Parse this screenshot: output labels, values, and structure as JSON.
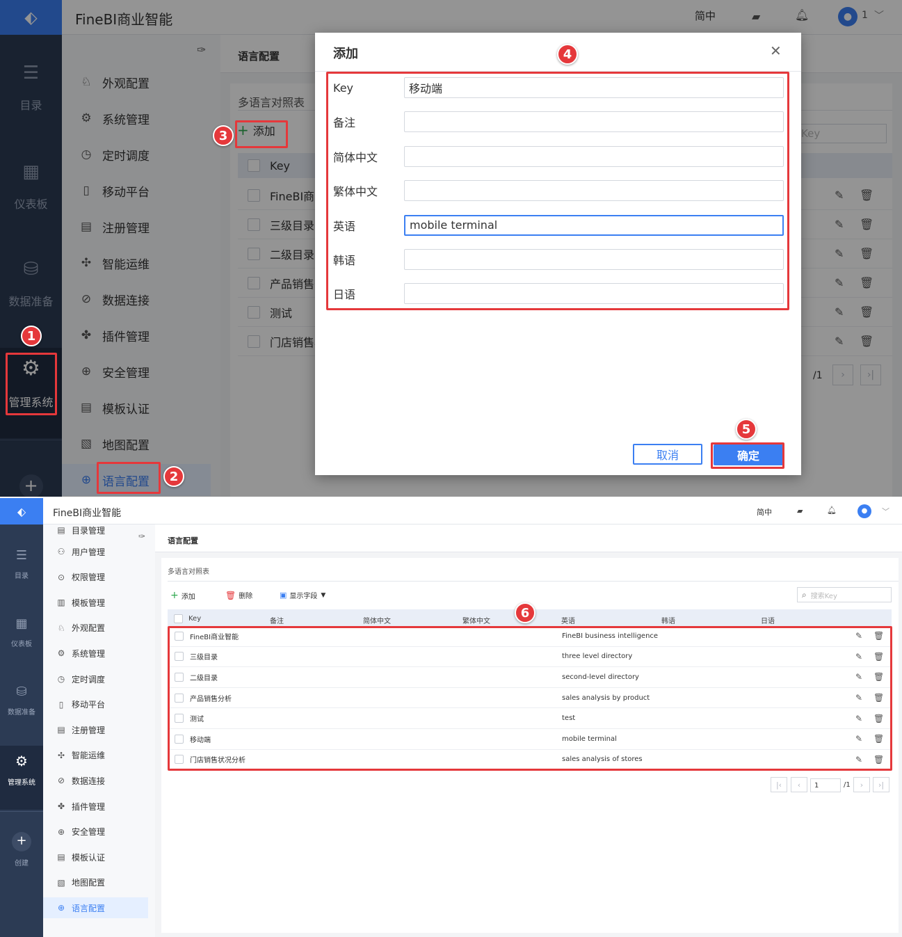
{
  "app": {
    "title": "FineBI商业智能",
    "lang": "简中",
    "user_badge": "1"
  },
  "rail": [
    {
      "label": "目录",
      "icon": "list-icon"
    },
    {
      "label": "仪表板",
      "icon": "dashboard-icon"
    },
    {
      "label": "数据准备",
      "icon": "database-icon"
    },
    {
      "label": "管理系统",
      "icon": "gear-icon"
    },
    {
      "label": "创建",
      "icon": "plus-icon"
    }
  ],
  "top_menu": [
    "外观配置",
    "系统管理",
    "定时调度",
    "移动平台",
    "注册管理",
    "智能运维",
    "数据连接",
    "插件管理",
    "安全管理",
    "模板认证",
    "地图配置",
    "语言配置"
  ],
  "bottom_menu": [
    "目录管理",
    "用户管理",
    "权限管理",
    "模板管理",
    "外观配置",
    "系统管理",
    "定时调度",
    "移动平台",
    "注册管理",
    "智能运维",
    "数据连接",
    "插件管理",
    "安全管理",
    "模板认证",
    "地图配置",
    "语言配置"
  ],
  "page": {
    "title": "语言配置",
    "subtitle": "多语言对照表",
    "add_label": "添加",
    "delete_label": "删除",
    "fields_label": "显示字段",
    "search_placeholder": "搜索Key",
    "search_placeholder_partial": "Key"
  },
  "table": {
    "columns": [
      "Key",
      "备注",
      "简体中文",
      "繁体中文",
      "英语",
      "韩语",
      "日语"
    ],
    "rows": [
      {
        "key": "FineBI商业智能",
        "en": "FineBI business intelligence",
        "key_partial": "FineBI商业"
      },
      {
        "key": "三级目录",
        "en": "three level directory",
        "key_partial": "三级目录"
      },
      {
        "key": "二级目录",
        "en": "second-level directory",
        "key_partial": "二级目录"
      },
      {
        "key": "产品销售分析",
        "en": "sales analysis by product",
        "key_partial": "产品销售分"
      },
      {
        "key": "测试",
        "en": "test",
        "key_partial": "测试"
      },
      {
        "key": "移动端",
        "en": "mobile terminal",
        "key_partial": ""
      },
      {
        "key": "门店销售状况分析",
        "en": "sales analysis of stores",
        "key_partial": "门店销售状"
      }
    ]
  },
  "pagination": {
    "current": "1",
    "total": "/1"
  },
  "modal": {
    "title": "添加",
    "fields": [
      {
        "label": "Key",
        "value": "移动端"
      },
      {
        "label": "备注",
        "value": ""
      },
      {
        "label": "简体中文",
        "value": ""
      },
      {
        "label": "繁体中文",
        "value": ""
      },
      {
        "label": "英语",
        "value": "mobile terminal"
      },
      {
        "label": "韩语",
        "value": ""
      },
      {
        "label": "日语",
        "value": ""
      }
    ],
    "cancel_label": "取消",
    "ok_label": "确定"
  },
  "steps": [
    "1",
    "2",
    "3",
    "4",
    "5",
    "6"
  ],
  "colors": {
    "accent": "#3b7ff2",
    "rail": "#2c3b54",
    "highlight": "#e5383b"
  }
}
